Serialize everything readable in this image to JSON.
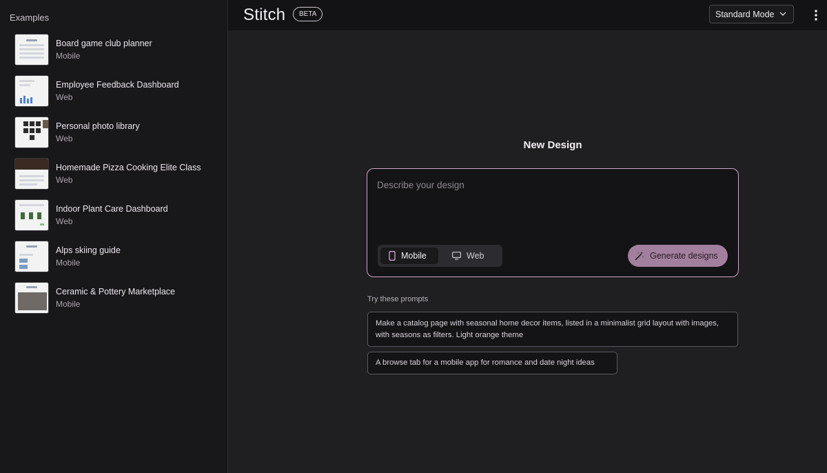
{
  "sidebar": {
    "title": "Examples",
    "items": [
      {
        "title": "Board game club planner",
        "subtitle": "Mobile"
      },
      {
        "title": "Employee Feedback Dashboard",
        "subtitle": "Web"
      },
      {
        "title": "Personal photo library",
        "subtitle": "Web"
      },
      {
        "title": "Homemade Pizza Cooking Elite Class",
        "subtitle": "Web"
      },
      {
        "title": "Indoor Plant Care Dashboard",
        "subtitle": "Web"
      },
      {
        "title": "Alps skiing guide",
        "subtitle": "Mobile"
      },
      {
        "title": "Ceramic & Pottery Marketplace",
        "subtitle": "Mobile"
      }
    ]
  },
  "header": {
    "brand": "Stitch",
    "badge": "BETA",
    "mode_select": "Standard Mode"
  },
  "main": {
    "heading": "New Design",
    "input_placeholder": "Describe your design",
    "device_options": [
      "Mobile",
      "Web"
    ],
    "selected_device": "Mobile",
    "generate_label": "Generate designs",
    "prompts_label": "Try these prompts",
    "prompts": [
      "Make a catalog page with seasonal home decor items, listed in a minimalist grid layout with images, with seasons as filters. Light orange theme",
      "A browse tab for a mobile app for romance and date night ideas"
    ]
  },
  "colors": {
    "accent": "#a37f9e",
    "accent_border": "#cfa9c8",
    "background": "#1f1e21",
    "sidebar": "#18171a"
  }
}
